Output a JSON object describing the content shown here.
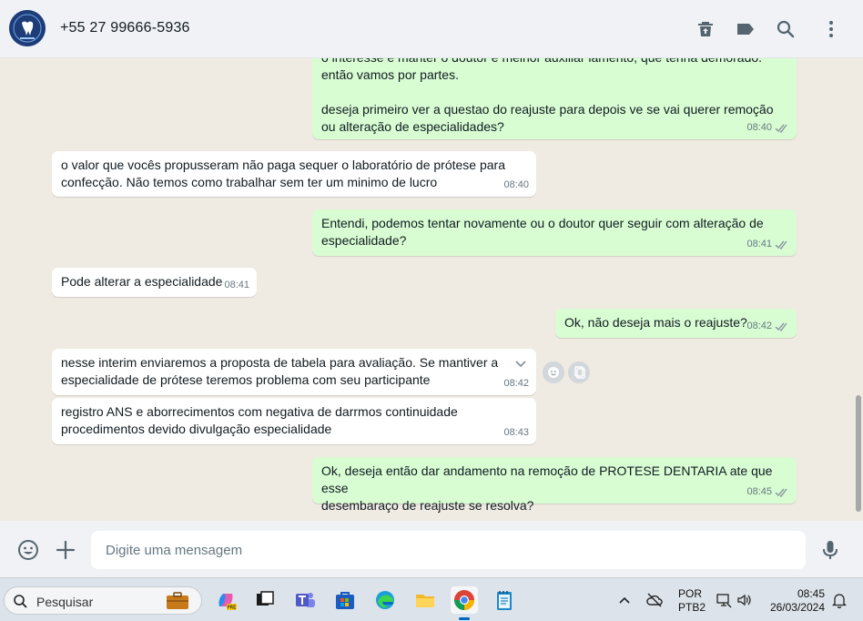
{
  "header": {
    "contact_name": "+55 27 99666-5936",
    "avatar_icon": "tooth-logo-icon",
    "actions": [
      "delete-icon",
      "label-icon",
      "search-icon",
      "menu-icon"
    ]
  },
  "messages": [
    {
      "direction": "out",
      "text": "o interesse é manter o doutor e melhor auxiliar lamento, que tenha demorado.\nentão vamos por partes.\n\ndeseja primeiro ver a questao do reajuste para depois ve se vai querer remoção\nou alteração de especialidades?",
      "time": "08:40",
      "read": true
    },
    {
      "direction": "in",
      "text": "o valor que vocês propusseram não paga sequer o laboratório de prótese para\nconfecção. Não temos como trabalhar sem ter um minimo de lucro",
      "time": "08:40"
    },
    {
      "direction": "out",
      "text": "Entendi, podemos tentar novamente ou o doutor quer seguir com alteração de\nespecialidade?",
      "time": "08:41",
      "read": true
    },
    {
      "direction": "in",
      "text": "Pode alterar a especialidade",
      "time": "08:41"
    },
    {
      "direction": "out",
      "text": "Ok, não deseja mais o reajuste?",
      "time": "08:42",
      "read": true
    },
    {
      "direction": "in",
      "text": "nesse interim enviaremos a proposta de tabela para avaliação. Se mantiver a\nespecialidade de prótese teremos problema com seu participante",
      "time": "08:42"
    },
    {
      "direction": "in",
      "text": "registro ANS e aborrecimentos com negativa de darrmos continuidade\nprocedimentos devido divulgação especialidade",
      "time": "08:43"
    },
    {
      "direction": "out",
      "text": "Ok, deseja então dar andamento na remoção de PROTESE DENTARIA ate que esse\ndesembaraço de reajuste se resolva?",
      "time": "08:45",
      "read": true
    }
  ],
  "composer": {
    "placeholder": "Digite uma mensagem",
    "emoji_icon": "emoji-icon",
    "attach_icon": "plus-icon",
    "mic_icon": "microphone-icon"
  },
  "taskbar": {
    "search_label": "Pesquisar",
    "apps": [
      "copilot-icon",
      "task-view-icon",
      "teams-icon",
      "store-icon",
      "edge-icon",
      "file-explorer-icon",
      "chrome-icon",
      "notepad-icon"
    ],
    "language": "POR",
    "keyboard": "PTB2",
    "time": "08:45",
    "date": "26/03/2024"
  },
  "colors": {
    "outgoing_bubble": "#d9fdd3",
    "incoming_bubble": "#ffffff",
    "chat_background": "#efeae2",
    "read_ticks": "#8696a0"
  }
}
